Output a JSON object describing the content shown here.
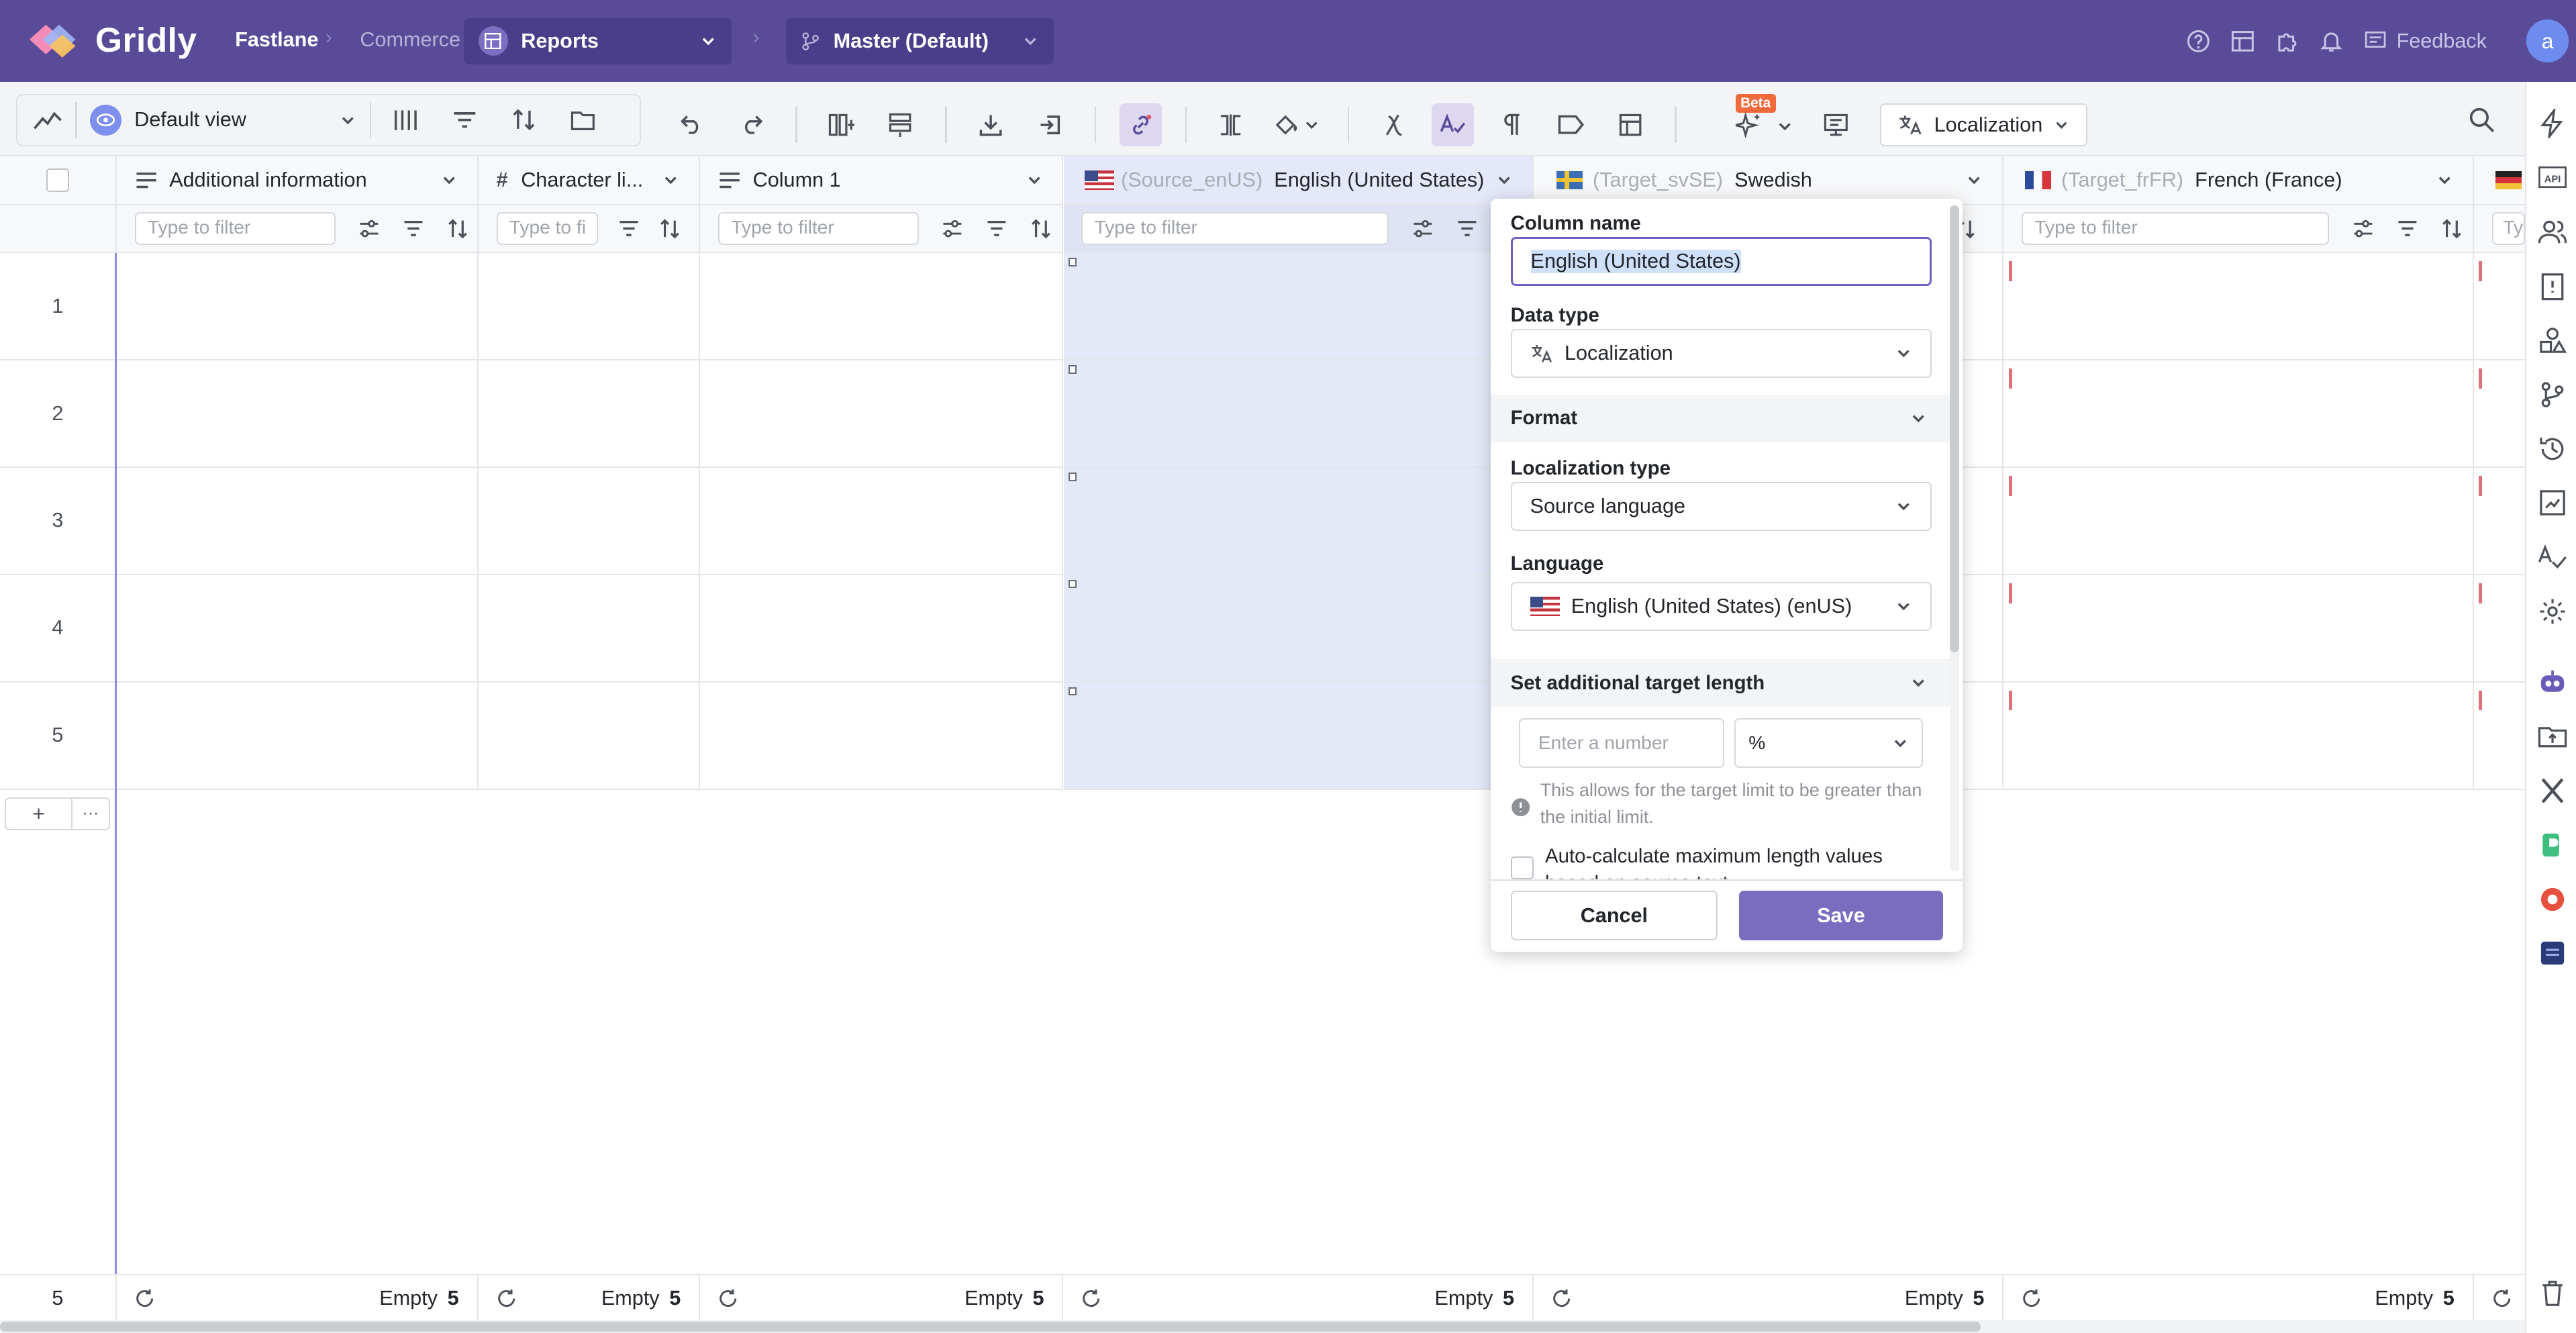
{
  "app": {
    "logo_text": "Gridly",
    "brand_color": "#5a4b99"
  },
  "breadcrumb": {
    "project": "Fastlane",
    "database": "Commerce",
    "grid": "Reports",
    "branch": "Master (Default)"
  },
  "topbar": {
    "feedback_label": "Feedback",
    "avatar_initial": "a"
  },
  "toolbar": {
    "view_label": "Default view",
    "beta_badge": "Beta",
    "localization_label": "Localization"
  },
  "columns": [
    {
      "type_icon": "text-icon",
      "title": "Additional information",
      "prefix": "",
      "filter_placeholder": "Type to filter"
    },
    {
      "type_icon": "hash-icon",
      "title": "Character li...",
      "prefix": "",
      "filter_placeholder": "Type to fi"
    },
    {
      "type_icon": "text-icon",
      "title": "Column 1",
      "prefix": "",
      "filter_placeholder": "Type to filter"
    },
    {
      "type_icon": "flag-us",
      "title": "English (United States)",
      "prefix": "(Source_enUS)",
      "filter_placeholder": "Type to filter"
    },
    {
      "type_icon": "flag-se",
      "title": "Swedish",
      "prefix": "(Target_svSE)",
      "filter_placeholder": ""
    },
    {
      "type_icon": "flag-fr",
      "title": "French (France)",
      "prefix": "(Target_frFR)",
      "filter_placeholder": "Type to filter"
    },
    {
      "type_icon": "flag-de",
      "title": "",
      "prefix": "",
      "filter_placeholder": "Ty"
    }
  ],
  "rows": [
    "1",
    "2",
    "3",
    "4",
    "5"
  ],
  "footer": {
    "row_count": "5",
    "empty_label": "Empty",
    "empty_count": "5"
  },
  "popover": {
    "column_name_label": "Column name",
    "column_name_value": "English (United States)",
    "data_type_label": "Data type",
    "data_type_value": "Localization",
    "format_label": "Format",
    "localization_type_label": "Localization type",
    "localization_type_value": "Source language",
    "language_label": "Language",
    "language_value": "English (United States) (enUS)",
    "target_length_label": "Set additional target length",
    "number_placeholder": "Enter a number",
    "unit_value": "%",
    "hint_text": "This allows for the target limit to be greater than the initial limit.",
    "autocalc_label": "Auto-calculate maximum length values based on source text",
    "cancel_label": "Cancel",
    "save_label": "Save"
  }
}
